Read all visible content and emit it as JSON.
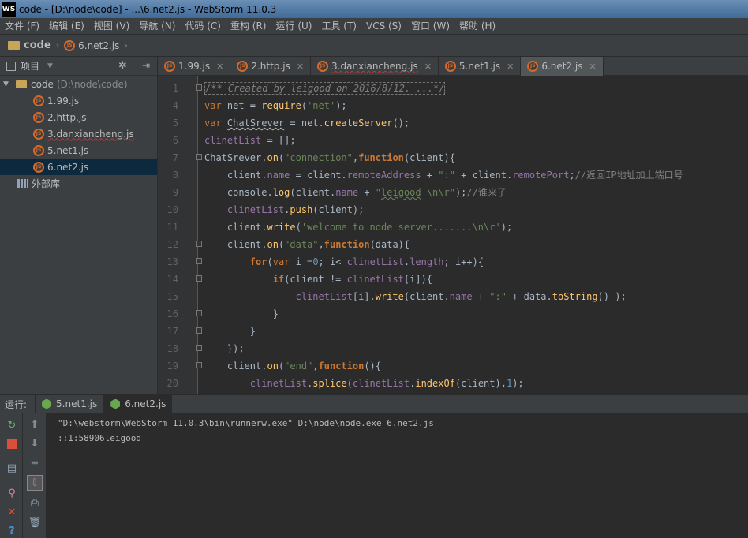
{
  "title_bar": {
    "logo": "WS",
    "text": "code - [D:\\node\\code] - ...\\6.net2.js - WebStorm 11.0.3"
  },
  "menu": [
    "文件 (F)",
    "编辑 (E)",
    "视图 (V)",
    "导航 (N)",
    "代码 (C)",
    "重构 (R)",
    "运行 (U)",
    "工具 (T)",
    "VCS (S)",
    "窗口 (W)",
    "帮助 (H)"
  ],
  "navbar": {
    "project": "code",
    "file": "6.net2.js"
  },
  "project_panel": {
    "title": "项目",
    "root": {
      "name": "code",
      "path": "(D:\\node\\code)"
    },
    "files": [
      "1.99.js",
      "2.http.js",
      "3.danxiancheng.js",
      "5.net1.js",
      "6.net2.js"
    ],
    "selected_file": "6.net2.js",
    "external": "外部库"
  },
  "tabs": [
    "1.99.js",
    "2.http.js",
    "3.danxiancheng.js",
    "5.net1.js",
    "6.net2.js"
  ],
  "active_tab": "6.net2.js",
  "line_numbers": [
    "1",
    "4",
    "5",
    "6",
    "7",
    "8",
    "9",
    "10",
    "11",
    "12",
    "13",
    "14",
    "15",
    "16",
    "17",
    "18",
    "19",
    "20"
  ],
  "code": [
    "/** Created by leigood on 2016/8/12. ...*/",
    "var net = require('net');",
    "var ChatSrever = net.createServer();",
    "clinetList = [];",
    "ChatSrever.on(\"connection\",function(client){",
    "    client.name = client.remoteAddress + \":\" + client.remotePort;//返回IP地址加上端口号",
    "    console.log(client.name + \"leigood \\n\\r\");//谁来了",
    "    clinetList.push(client);",
    "    client.write('welcome to node server.......\\n\\r');",
    "    client.on(\"data\",function(data){",
    "        for(var i =0; i< clinetList.length; i++){",
    "            if(client != clinetList[i]){",
    "                clinetList[i].write(client.name + \":\" + data.toString() );",
    "            }",
    "        }",
    "    });",
    "    client.on(\"end\",function(){",
    "        clinetList.splice(clinetList.indexOf(client),1);"
  ],
  "run_panel": {
    "label": "运行:",
    "tabs": [
      "5.net1.js",
      "6.net2.js"
    ],
    "active_tab": "6.net2.js",
    "console": [
      "\"D:\\webstorm\\WebStorm 11.0.3\\bin\\runnerw.exe\" D:\\node\\node.exe 6.net2.js",
      "::1:58906leigood"
    ]
  },
  "colors": {
    "keyword": "#cc7832",
    "string": "#6a8759",
    "property": "#9876aa",
    "function": "#ffc66d",
    "comment": "#808080",
    "number": "#6897bb"
  }
}
